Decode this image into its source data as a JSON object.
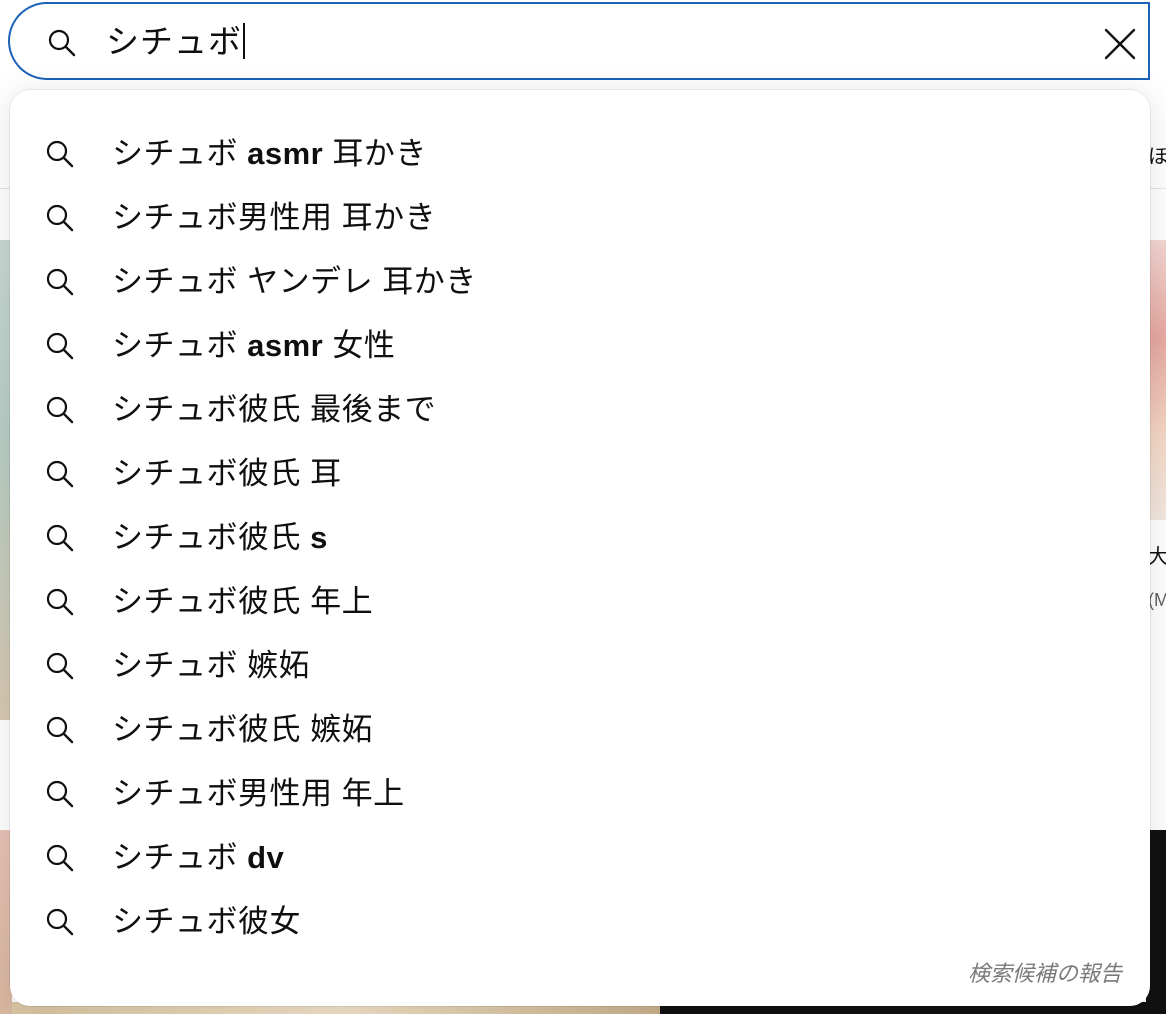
{
  "search": {
    "query": "シチュボ",
    "clear_label": "×"
  },
  "suggestions": [
    {
      "prefix": "シチュボ",
      "rest": " asmr",
      "tail": " 耳かき",
      "bold": true
    },
    {
      "prefix": "シチュボ",
      "rest": "男性用 耳かき",
      "tail": "",
      "bold": false
    },
    {
      "prefix": "シチュボ",
      "rest": " ヤンデレ 耳かき",
      "tail": "",
      "bold": false
    },
    {
      "prefix": "シチュボ",
      "rest": " asmr",
      "tail": " 女性",
      "bold": true
    },
    {
      "prefix": "シチュボ",
      "rest": "彼氏 最後まで",
      "tail": "",
      "bold": false
    },
    {
      "prefix": "シチュボ",
      "rest": "彼氏 耳",
      "tail": "",
      "bold": false
    },
    {
      "prefix": "シチュボ",
      "rest": "彼氏",
      "tail": " s",
      "bold": "tail"
    },
    {
      "prefix": "シチュボ",
      "rest": "彼氏 年上",
      "tail": "",
      "bold": false
    },
    {
      "prefix": "シチュボ",
      "rest": " 嫉妬",
      "tail": "",
      "bold": false
    },
    {
      "prefix": "シチュボ",
      "rest": "彼氏 嫉妬",
      "tail": "",
      "bold": false
    },
    {
      "prefix": "シチュボ",
      "rest": "男性用 年上",
      "tail": "",
      "bold": false
    },
    {
      "prefix": "シチュボ",
      "rest": " dv",
      "tail": "",
      "bold": true
    },
    {
      "prefix": "シチュボ",
      "rest": "彼女",
      "tail": "",
      "bold": false
    }
  ],
  "footer": {
    "report_label": "検索候補の報告"
  },
  "background": {
    "right_text_1": "ほ大",
    "right_text_2": "大",
    "right_text_3": "(M"
  },
  "icons": {
    "search": "search-icon",
    "clear": "close-icon"
  },
  "colors": {
    "focus_border": "#1c62b9",
    "text": "#0f0f0f",
    "muted": "#7a7a7a"
  }
}
